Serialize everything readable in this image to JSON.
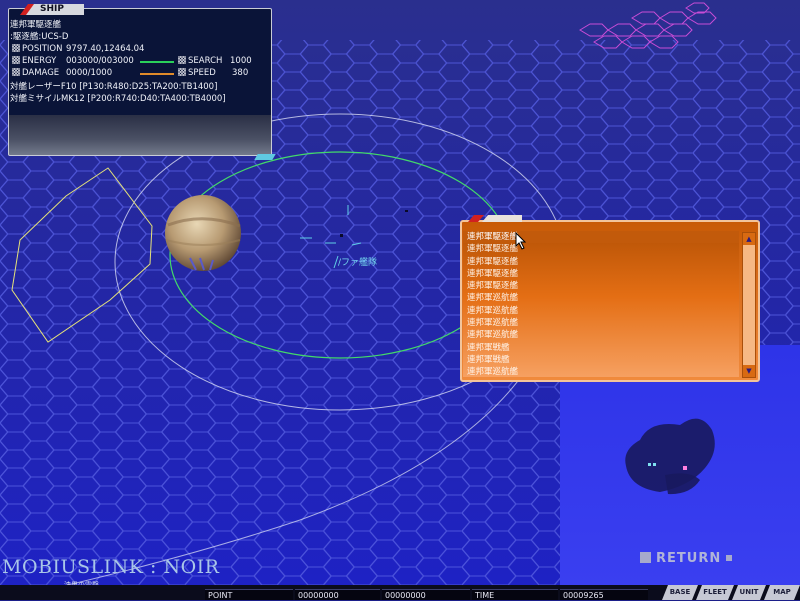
{
  "ship_panel": {
    "tab_label": "SHIP",
    "ship_name": "連邦軍駆逐艦",
    "ship_class": ":駆逐艦:UCS-D",
    "position_label": "POSITION",
    "position_value": "9797.40,12464.04",
    "energy_label": "ENERGY",
    "energy_value": "003000/003000",
    "damage_label": "DAMAGE",
    "damage_value": "0000/1000",
    "search_label": "SEARCH",
    "search_value": "1000",
    "speed_label": "SPEED",
    "speed_value": "380",
    "weapon_1": "対艦レーザーF10 [P130:R480:D25:TA200:TB1400]",
    "weapon_2": "対艦ミサイルMK12 [P200:R740:D40:TA400:TB4000]",
    "energy_bar_color": "#2ad05a",
    "damage_bar_color": "#e08a2a"
  },
  "map": {
    "fleet_label": "/ファ艦隊"
  },
  "fleet_list": {
    "items": [
      "連邦軍駆逐艦",
      "連邦軍駆逐艦",
      "連邦軍駆逐艦",
      "連邦軍駆逐艦",
      "連邦軍駆逐艦",
      "連邦軍巡航艦",
      "連邦軍巡航艦",
      "連邦軍巡航艦",
      "連邦軍巡航艦",
      "連邦軍戦艦",
      "連邦軍戦艦",
      "連邦軍巡航艦"
    ],
    "selected_index": 0
  },
  "return_button": {
    "label": "RETURN"
  },
  "logo": {
    "title": "MOBIUSLINK : NOIR",
    "subtitle": "漆黒の雷撃"
  },
  "bottom_bar": {
    "point_label": "POINT",
    "value_1": "00000000",
    "value_2": "00000000",
    "time_label": "TIME",
    "value_3": "00009265",
    "tabs": [
      "BASE",
      "FLEET",
      "UNIT",
      "MAP"
    ]
  },
  "colors": {
    "space_blue": "#1c1f8a",
    "hex_line": "#5157d8",
    "fleet_panel_orange": "#e46e14",
    "minimap_blue": "#3035e0",
    "orbit_green": "#43d96a"
  }
}
